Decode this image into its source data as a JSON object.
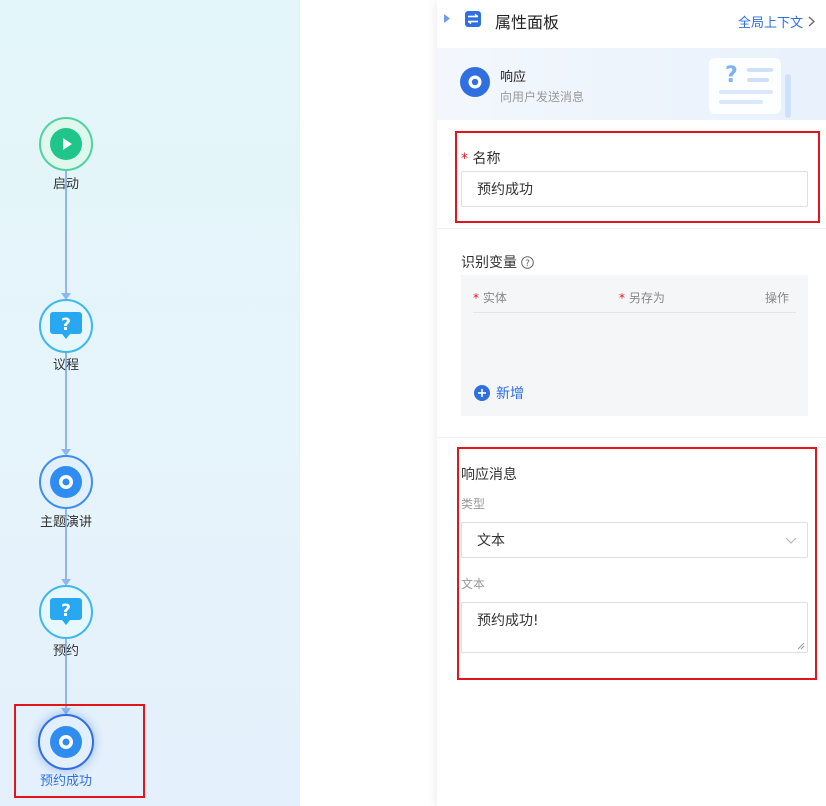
{
  "flow": {
    "nodes": [
      {
        "label": "启动",
        "kind": "start"
      },
      {
        "label": "议程",
        "kind": "question"
      },
      {
        "label": "主题演讲",
        "kind": "response"
      },
      {
        "label": "预约",
        "kind": "question"
      },
      {
        "label": "预约成功",
        "kind": "response-selected"
      }
    ]
  },
  "panel": {
    "title": "属性面板",
    "global_context_link": "全局上下文",
    "node_type": {
      "title": "响应",
      "description": "向用户发送消息"
    },
    "name_field": {
      "required_mark": "*",
      "label": "名称",
      "value": "预约成功"
    },
    "variables": {
      "label": "识别变量",
      "columns": [
        {
          "required_mark": "*",
          "label": "实体"
        },
        {
          "required_mark": "*",
          "label": "另存为"
        },
        {
          "required_mark": "",
          "label": "操作"
        }
      ],
      "add_label": "新增"
    },
    "response_message": {
      "title": "响应消息",
      "type_label": "类型",
      "type_value": "文本",
      "text_label": "文本",
      "text_value": "预约成功!"
    }
  },
  "colors": {
    "accent": "#2f6fe0",
    "start_green": "#1fc58a",
    "question_blue": "#27a8f0",
    "selection_red": "#e0161c"
  }
}
